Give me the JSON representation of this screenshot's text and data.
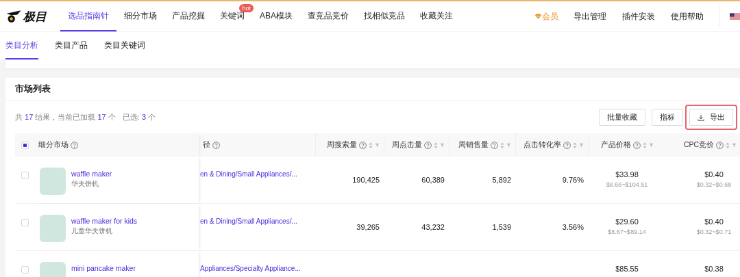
{
  "nav": {
    "logo": "极目",
    "items": [
      {
        "label": "选品指南针",
        "selected": true
      },
      {
        "label": "细分市场",
        "selected": false
      },
      {
        "label": "产品挖掘",
        "selected": false
      },
      {
        "label": "关键词",
        "selected": false,
        "badge": "hot"
      },
      {
        "label": "ABA模块",
        "selected": false
      },
      {
        "label": "查竞品竞价",
        "selected": false
      },
      {
        "label": "找相似竞品",
        "selected": false
      },
      {
        "label": "收藏关注",
        "selected": false
      }
    ],
    "member": "会员",
    "links": [
      "导出管理",
      "插件安装",
      "使用帮助"
    ]
  },
  "subtabs": [
    {
      "label": "类目分析",
      "selected": true
    },
    {
      "label": "类目产品",
      "selected": false
    },
    {
      "label": "类目关键词",
      "selected": false
    }
  ],
  "card": {
    "title": "市场列表",
    "result_text": [
      {
        "text": "共 ",
        "highlight": false
      },
      {
        "text": "17",
        "highlight": true
      },
      {
        "text": " 结果，当前已加载 ",
        "highlight": false
      },
      {
        "text": "17",
        "highlight": true
      },
      {
        "text": " 个",
        "highlight": false
      }
    ],
    "selected_text": [
      {
        "text": "已选: ",
        "highlight": false
      },
      {
        "text": "3",
        "highlight": true
      },
      {
        "text": " 个",
        "highlight": false
      }
    ],
    "buttons": [
      {
        "label": "批量收藏",
        "highlighted": false,
        "icon": false
      },
      {
        "label": "指标",
        "highlighted": false,
        "icon": false
      },
      {
        "label": "导出",
        "highlighted": true,
        "icon": true
      }
    ]
  },
  "table": {
    "select_all_partial": true,
    "columns": [
      {
        "label": "细分市场",
        "sortable": false
      },
      {
        "label": "径",
        "sortable": false
      },
      {
        "label": "周搜索量",
        "sortable": true
      },
      {
        "label": "周点击量",
        "sortable": true
      },
      {
        "label": "周销售量",
        "sortable": true
      },
      {
        "label": "点击转化率",
        "sortable": true
      },
      {
        "label": "产品价格",
        "sortable": true
      },
      {
        "label": "CPC竞价",
        "sortable": true
      }
    ],
    "rows": [
      {
        "selected": false,
        "name": "waffle maker",
        "name_cn": "华夫饼机",
        "path": "en & Dining/Small Appliances/...",
        "search": "190,425",
        "clicks": "60,389",
        "sales": "5,892",
        "conversion": "9.76%",
        "price": "$33.98",
        "price_range": "$8.66~$104.51",
        "cpc": "$0.40",
        "cpc_range": "$0.32~$0.68"
      },
      {
        "selected": false,
        "name": "waffle maker for kids",
        "name_cn": "儿童华夫饼机",
        "path": "en & Dining/Small Appliances/...",
        "search": "39,265",
        "clicks": "43,232",
        "sales": "1,539",
        "conversion": "3.56%",
        "price": "$29.60",
        "price_range": "$8.67~$89.14",
        "cpc": "$0.40",
        "cpc_range": "$0.32~$0.71"
      },
      {
        "selected": false,
        "name": "mini pancake maker",
        "path": "Appliances/Specialty Appliance...",
        "price": "$85.55",
        "cpc": "$0.38"
      }
    ]
  }
}
